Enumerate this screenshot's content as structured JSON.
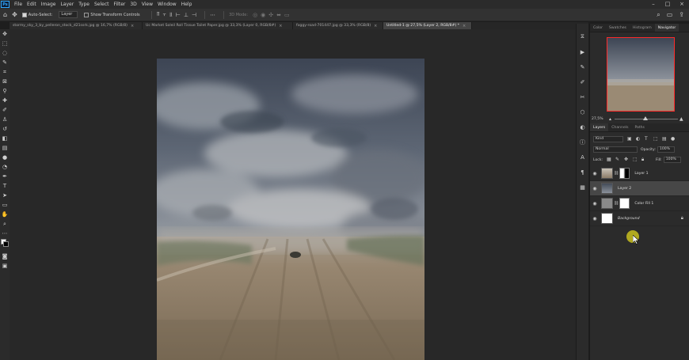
{
  "app": {
    "logo": "Ps"
  },
  "menu": [
    "File",
    "Edit",
    "Image",
    "Layer",
    "Type",
    "Select",
    "Filter",
    "3D",
    "View",
    "Window",
    "Help"
  ],
  "window_controls": [
    "–",
    "□",
    "×"
  ],
  "options_bar": {
    "move_icon": "move-icon",
    "auto_select_label": "Auto-Select:",
    "auto_select_value": "Layer",
    "show_transform_label": "Show Transform Controls",
    "mode_3d_label": "3D Mode:"
  },
  "tabs": [
    {
      "label": "stormy_sky_3_by_pelleron_stock_d21ssrk.jpg @ 16,7% (RGB/8)",
      "close": "×",
      "active": false
    },
    {
      "label": "Uc Market Soleil Roll Tissue Toilet Paper.jpg @ 33,3% (Layer 0, RGB/8#)",
      "close": "×",
      "active": false
    },
    {
      "label": "foggy-road-701447.jpg @ 33,3% (RGB/8)",
      "close": "×",
      "active": false
    },
    {
      "label": "Untitled-1 @ 27,5% (Layer 2, RGB/8#) *",
      "close": "×",
      "active": true
    }
  ],
  "panels": {
    "top_tabs": [
      "Color",
      "Swatches",
      "Histogram",
      "Navigator"
    ],
    "active_top_tab": "Navigator",
    "navigator_zoom": "27,5%",
    "layer_tabs": [
      "Layers",
      "Channels",
      "Paths"
    ],
    "active_layer_tab": "Layers",
    "filter_kind": "Kind",
    "blend_mode": "Normal",
    "opacity_label": "Opacity:",
    "opacity_value": "100%",
    "lock_label": "Lock:",
    "fill_label": "Fill:",
    "fill_value": "100%"
  },
  "layers": [
    {
      "name": "Layer 1",
      "selected": false,
      "italic": false,
      "has_mask": true
    },
    {
      "name": "Layer 2",
      "selected": true,
      "italic": false,
      "has_mask": false
    },
    {
      "name": "Color Fill 1",
      "selected": false,
      "italic": false,
      "has_mask": true
    },
    {
      "name": "Background",
      "selected": false,
      "italic": true,
      "has_mask": false,
      "locked": true
    }
  ],
  "colors": {
    "accent_red": "#ff2a2a",
    "cursor_highlight": "#c8be1e",
    "selected_layer": "#474747"
  }
}
